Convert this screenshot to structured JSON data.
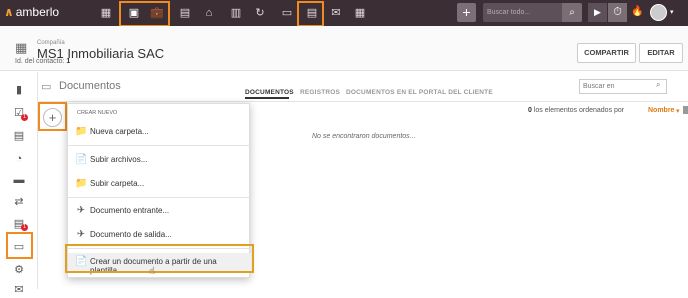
{
  "app": {
    "logo": "amberlo",
    "logo_mark": "∧"
  },
  "topbar": {
    "nav_icons": [
      "dashboard-icon",
      "contacts-icon",
      "briefcase-icon",
      "document-icon",
      "bank-icon",
      "calendar-icon",
      "history-icon",
      "folder-icon",
      "document-template-icon",
      "mail-icon",
      "reports-icon"
    ],
    "search_placeholder": "Buscar todo...",
    "plus": "+",
    "search_glyph": "⌕",
    "play_glyph": "▶",
    "timer_glyph": "⏱",
    "flame_glyph": "🔥",
    "caret_glyph": "▾"
  },
  "header": {
    "company_label": "Compañía",
    "company_name": "MS1 Inmobiliaria SAC",
    "contact_id_label": "Id. del contacto:",
    "contact_id_value": "1",
    "share_label": "COMPARTIR",
    "edit_label": "EDITAR"
  },
  "sidebar": {
    "items": [
      "book-icon",
      "tasks-icon",
      "billing-icon",
      "time-icon",
      "briefcase-icon",
      "transfer-icon",
      "invoice-icon",
      "documents-icon",
      "settings-icon",
      "mail-icon"
    ],
    "badges": {
      "tasks": "1",
      "invoice": "1"
    }
  },
  "documents": {
    "title": "Documentos",
    "tabs": [
      "DOCUMENTOS",
      "REGISTROS",
      "DOCUMENTOS EN EL PORTAL DEL CLIENTE"
    ],
    "search_placeholder": "Buscar en",
    "count_value": "0",
    "count_text": "los elementos ordenados por",
    "sort_label": "Nombre",
    "sort_arrow": "▾",
    "empty_text": "No se encontraron documentos...",
    "add_glyph": "+"
  },
  "menu": {
    "header": "CREAR NUEVO",
    "items": [
      {
        "label": "Nueva carpeta...",
        "icon": "new-folder-icon",
        "glyph": "📁"
      },
      {
        "label": "Subir archivos...",
        "icon": "upload-file-icon",
        "glyph": "📄"
      },
      {
        "label": "Subir carpeta...",
        "icon": "upload-folder-icon",
        "glyph": "📁"
      },
      {
        "label": "Documento entrante...",
        "icon": "incoming-plane-icon",
        "glyph": "✈"
      },
      {
        "label": "Documento de salida...",
        "icon": "outgoing-plane-icon",
        "glyph": "✈"
      },
      {
        "label": "Crear un documento a partir de una plantilla...",
        "icon": "template-doc-icon",
        "glyph": "📄"
      }
    ]
  },
  "colors": {
    "accent": "#f08c1e",
    "topbar": "#3b2e35",
    "highlight": "#e0a020"
  }
}
